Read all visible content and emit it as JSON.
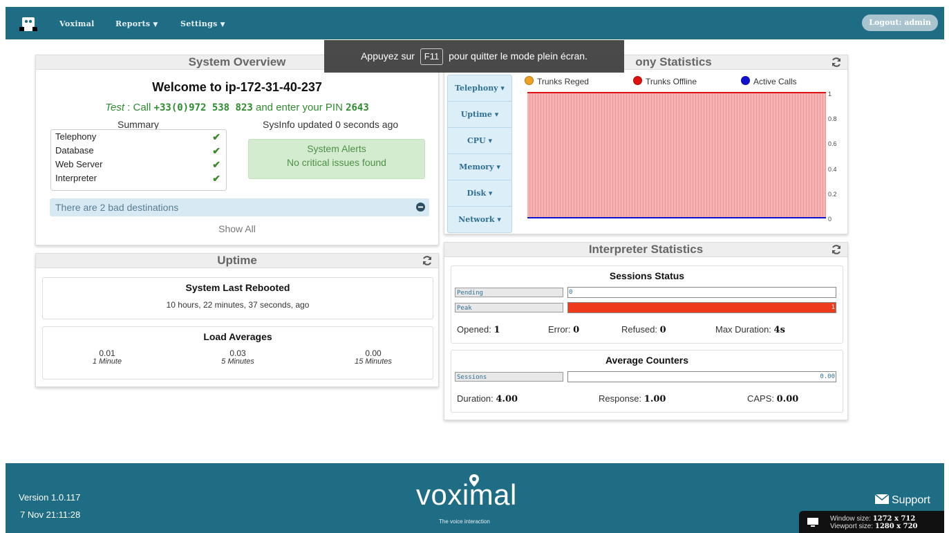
{
  "nav": {
    "brand": "Voximal",
    "reports": "Reports",
    "settings": "Settings",
    "logout": "Logout: admin"
  },
  "fullscreen": {
    "prefix": "Appuyez sur",
    "key": "F11",
    "suffix": "pour quitter le mode plein écran."
  },
  "overview": {
    "title": "System Overview",
    "welcome": "Welcome to ip-172-31-40-237",
    "test_label": "Test",
    "test_call": ": Call",
    "phone": "+33(0)972 538 823",
    "pin_text": "and enter your PIN",
    "pin": "2643",
    "summary_title": "Summary",
    "sysinfo": "SysInfo updated 0 seconds ago",
    "summary": [
      {
        "label": "Telephony",
        "status": "ok"
      },
      {
        "label": "Database",
        "status": "ok"
      },
      {
        "label": "Web Server",
        "status": "ok"
      },
      {
        "label": "Interpreter",
        "status": "ok"
      }
    ],
    "alerts_title": "System Alerts",
    "alerts_text": "No critical issues found",
    "bad_destinations": "There are 2 bad destinations",
    "show_all": "Show All"
  },
  "uptime": {
    "title": "Uptime",
    "rebooted_title": "System Last Rebooted",
    "rebooted_text": "10 hours, 22 minutes, 37 seconds, ago",
    "load_title": "Load Averages",
    "loads": [
      {
        "value": "0.01",
        "label": "1 Minute"
      },
      {
        "value": "0.03",
        "label": "5 Minutes"
      },
      {
        "value": "0.00",
        "label": "15 Minutes"
      }
    ]
  },
  "telephony": {
    "title": "Telephony Statistics",
    "title_visible": "ony Statistics",
    "tabs": [
      "Telephony",
      "Uptime",
      "CPU",
      "Memory",
      "Disk",
      "Network"
    ]
  },
  "chart_data": {
    "type": "area",
    "series": [
      {
        "name": "Trunks Reged",
        "color": "#f0a020",
        "values": [
          0
        ]
      },
      {
        "name": "Trunks Offline",
        "color": "#e01010",
        "values": [
          1
        ]
      },
      {
        "name": "Active Calls",
        "color": "#1010d0",
        "values": [
          0
        ]
      }
    ],
    "ylim": [
      0,
      1
    ],
    "yticks": [
      "1",
      "0.8",
      "0.6",
      "0.4",
      "0.2",
      "0"
    ],
    "grid": true,
    "legend": "top"
  },
  "interpreter": {
    "title": "Interpreter Statistics",
    "sessions_title": "Sessions Status",
    "pending_label": "Pending",
    "pending_value": "0",
    "pending_fraction": 0,
    "peak_label": "Peak",
    "peak_value": "1",
    "peak_fraction": 1,
    "opened_label": "Opened:",
    "opened": "1",
    "error_label": "Error:",
    "error": "0",
    "refused_label": "Refused:",
    "refused": "0",
    "maxdur_label": "Max Duration:",
    "maxdur": "4s",
    "counters_title": "Average Counters",
    "sessions_label": "Sessions",
    "sessions_value": "0.00",
    "duration_label": "Duration:",
    "duration": "4.00",
    "response_label": "Response:",
    "response": "1.00",
    "caps_label": "CAPS:",
    "caps": "0.00"
  },
  "footer": {
    "version": "Version 1.0.117",
    "date": "7 Nov 21:11:28",
    "brand": "voximal",
    "tagline": "The voice interaction",
    "support": "Support",
    "window_label": "Window size:",
    "window_value": "1272 x 712",
    "viewport_label": "Viewport size:",
    "viewport_value": "1280 x 720"
  }
}
